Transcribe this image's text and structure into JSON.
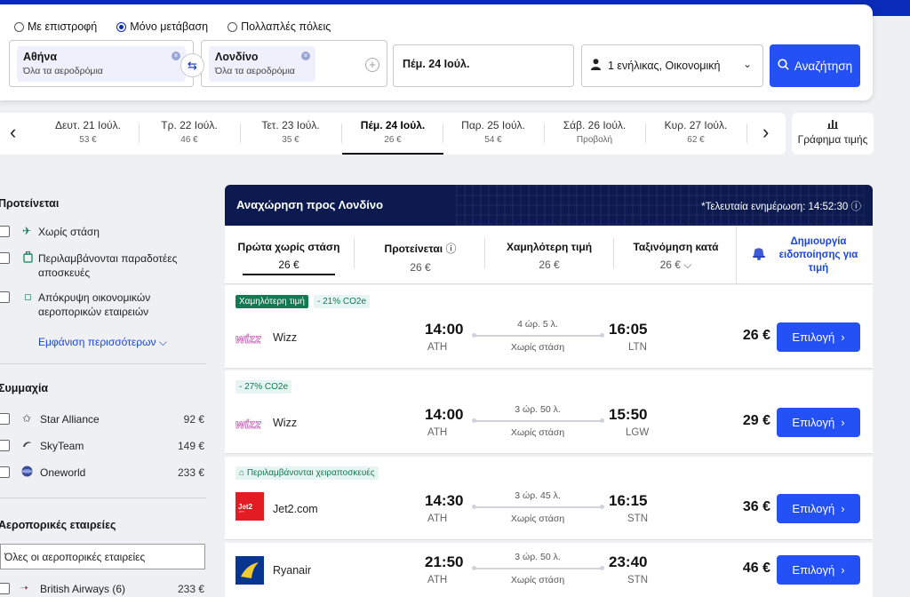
{
  "trip_types": [
    {
      "label": "Με επιστροφή",
      "selected": false
    },
    {
      "label": "Μόνο μετάβαση",
      "selected": true
    },
    {
      "label": "Πολλαπλές πόλεις",
      "selected": false
    }
  ],
  "origin": {
    "city": "Αθήνα",
    "sub": "Όλα τα αεροδρόμια"
  },
  "destination": {
    "city": "Λονδίνο",
    "sub": "Όλα τα αεροδρόμια"
  },
  "date_value": "Πέμ. 24 Ιούλ.",
  "passengers": "1 ενήλικας, Οικονομική",
  "search_label": "Αναζήτηση",
  "dates": [
    {
      "label": "Δευτ. 21 Ιούλ.",
      "price": "53 €"
    },
    {
      "label": "Τρ. 22 Ιούλ.",
      "price": "46 €"
    },
    {
      "label": "Τετ. 23 Ιούλ.",
      "price": "35 €"
    },
    {
      "label": "Πέμ. 24 Ιούλ.",
      "price": "26 €",
      "active": true
    },
    {
      "label": "Παρ. 25 Ιούλ.",
      "price": "54 €"
    },
    {
      "label": "Σάβ. 26 Ιούλ.",
      "price": "Προβολή"
    },
    {
      "label": "Κυρ. 27 Ιούλ.",
      "price": "62 €"
    }
  ],
  "price_graph_label": "Γράφημα τιμής",
  "sidebar": {
    "recommended_title": "Προτείνεται",
    "recommended": [
      {
        "label": "Χωρίς στάση",
        "icon": "plane-icon"
      },
      {
        "label": "Περιλαμβάνονται παραδοτέες αποσκευές",
        "icon": "luggage-icon"
      },
      {
        "label": "Απόκρυψη οικονομικών αεροπορικών εταιρειών",
        "icon": "tag-icon"
      }
    ],
    "show_more": "Εμφάνιση περισσότερων",
    "alliance_title": "Συμμαχία",
    "alliances": [
      {
        "label": "Star Alliance",
        "price": "92 €"
      },
      {
        "label": "SkyTeam",
        "price": "149 €"
      },
      {
        "label": "Oneworld",
        "price": "233 €"
      }
    ],
    "airlines_title": "Αεροπορικές εταιρείες",
    "all_airlines": "Όλες οι αεροπορικές εταιρείες",
    "airline_first": {
      "label": "British Airways (6)",
      "price": "233 €"
    }
  },
  "results": {
    "title": "Αναχώρηση προς Λονδίνο",
    "updated": "*Τελευταία ενημέρωση: 14:52:30",
    "sort_tabs": [
      {
        "label": "Πρώτα χωρίς στάση",
        "price": "26 €",
        "active": true
      },
      {
        "label": "Προτείνεται",
        "price": "26 €"
      },
      {
        "label": "Χαμηλότερη τιμή",
        "price": "26 €"
      },
      {
        "label": "Ταξινόμηση κατά",
        "price": "26 €"
      }
    ],
    "alert_label": "Δημιουργία ειδοποίησης για τιμή",
    "select_label": "Επιλογή",
    "flights": [
      {
        "tags": [
          {
            "text": "Χαμηλότερη τιμή",
            "style": "green"
          },
          {
            "text": "- 21% CO2e",
            "style": "teal"
          }
        ],
        "carrier": "Wizz",
        "dep": "14:00",
        "from": "ATH",
        "duration": "4 ώρ. 5 λ.",
        "stops": "Χωρίς στάση",
        "arr": "16:05",
        "to": "LTN",
        "price": "26 €"
      },
      {
        "tags": [
          {
            "text": "- 27% CO2e",
            "style": "teal"
          }
        ],
        "carrier": "Wizz",
        "dep": "14:00",
        "from": "ATH",
        "duration": "3 ώρ. 50 λ.",
        "stops": "Χωρίς στάση",
        "arr": "15:50",
        "to": "LGW",
        "price": "29 €"
      },
      {
        "tags": [
          {
            "text": "Περιλαμβάνονται χειραποσκευές",
            "style": "teal"
          }
        ],
        "carrier": "Jet2.com",
        "dep": "14:30",
        "from": "ATH",
        "duration": "3 ώρ. 45 λ.",
        "stops": "Χωρίς στάση",
        "arr": "16:15",
        "to": "STN",
        "price": "36 €"
      },
      {
        "tags": [],
        "carrier": "Ryanair",
        "dep": "21:50",
        "from": "ATH",
        "duration": "3 ώρ. 50 λ.",
        "stops": "Χωρίς στάση",
        "arr": "23:40",
        "to": "STN",
        "price": "46 €"
      }
    ]
  },
  "colors": {
    "primary": "#2351f5",
    "header": "#0d1a4f",
    "green": "#117a52"
  }
}
